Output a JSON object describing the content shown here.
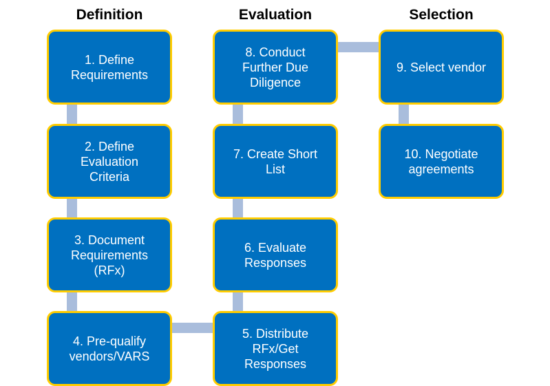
{
  "headers": {
    "definition": "Definition",
    "evaluation": "Evaluation",
    "selection": "Selection"
  },
  "steps": [
    "1. Define\nRequirements",
    "2. Define\nEvaluation\nCriteria",
    "3. Document\nRequirements\n(RFx)",
    "4. Pre-qualify\nvendors/VARS",
    "5. Distribute\nRFx/Get\nResponses",
    "6. Evaluate\nResponses",
    "7. Create Short\nList",
    "8. Conduct\nFurther Due\nDiligence",
    "9. Select vendor",
    "10. Negotiate\nagreements"
  ],
  "colors": {
    "box_fill": "#0070c0",
    "box_border": "#ffcc00",
    "connector": "#a9bddc"
  }
}
